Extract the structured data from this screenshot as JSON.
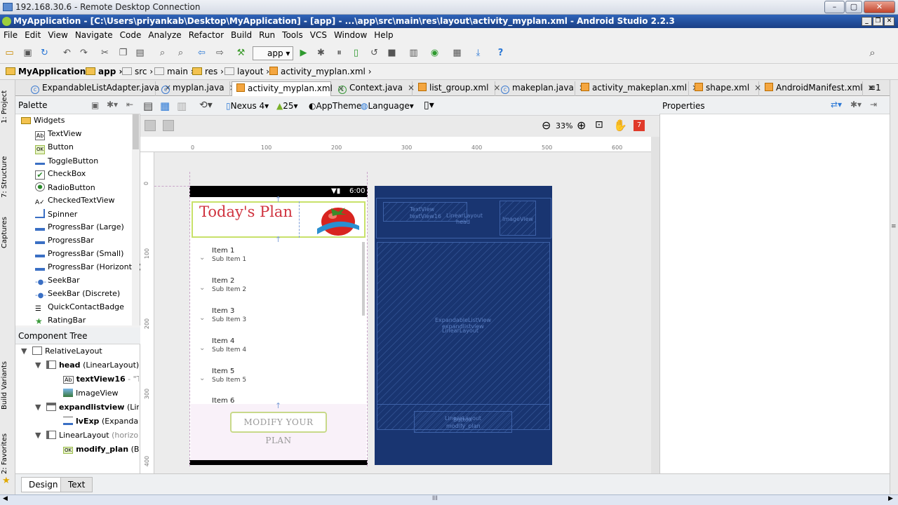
{
  "rdp": {
    "title": "192.168.30.6 - Remote Desktop Connection",
    "min": "–",
    "max": "▢",
    "close": "✕"
  },
  "window": {
    "title": "MyApplication - [C:\\Users\\priyankab\\Desktop\\MyApplication] - [app] - ...\\app\\src\\main\\res\\layout\\activity_myplan.xml - Android Studio 2.2.3"
  },
  "menu": [
    "File",
    "Edit",
    "View",
    "Navigate",
    "Code",
    "Analyze",
    "Refactor",
    "Build",
    "Run",
    "Tools",
    "VCS",
    "Window",
    "Help"
  ],
  "toolbar": {
    "app_config": "app",
    "help": "?"
  },
  "breadcrumb": [
    "MyApplication",
    "app",
    "src",
    "main",
    "res",
    "layout",
    "activity_myplan.xml"
  ],
  "tabs": [
    {
      "label": "ExpandableListAdapter.java",
      "type": "java"
    },
    {
      "label": "myplan.java",
      "type": "java"
    },
    {
      "label": "activity_myplan.xml",
      "type": "xml",
      "active": true
    },
    {
      "label": "Context.java",
      "type": "java"
    },
    {
      "label": "list_group.xml",
      "type": "xml"
    },
    {
      "label": "makeplan.java",
      "type": "java"
    },
    {
      "label": "activity_makeplan.xml",
      "type": "xml"
    },
    {
      "label": "shape.xml",
      "type": "xml"
    },
    {
      "label": "AndroidManifest.xml",
      "type": "xml"
    }
  ],
  "tabs_overflow": "≡1",
  "left_strip": [
    "1: Project",
    "7: Structure",
    "Captures",
    "Build Variants",
    "2: Favorites"
  ],
  "palette": {
    "title": "Palette",
    "group": "Widgets",
    "items": [
      "TextView",
      "Button",
      "ToggleButton",
      "CheckBox",
      "RadioButton",
      "CheckedTextView",
      "Spinner",
      "ProgressBar (Large)",
      "ProgressBar",
      "ProgressBar (Small)",
      "ProgressBar (Horizontal)",
      "SeekBar",
      "SeekBar (Discrete)",
      "QuickContactBadge",
      "RatingBar"
    ]
  },
  "component_tree": {
    "title": "Component Tree",
    "nodes": [
      {
        "name": "RelativeLayout",
        "extra": ""
      },
      {
        "name": "head",
        "extra": "(LinearLayout)",
        "trail": "(h"
      },
      {
        "name": "textView16",
        "extra": "- \"To"
      },
      {
        "name": "ImageView",
        "extra": ""
      },
      {
        "name": "expandlistview",
        "extra": "(Line"
      },
      {
        "name": "lvExp",
        "extra": "(Expandable"
      },
      {
        "name": "LinearLayout",
        "extra": "(horizonta"
      },
      {
        "name": "modify_plan",
        "extra": "(Bu"
      }
    ]
  },
  "editor_toolbar": {
    "device": "Nexus 4",
    "api": "25",
    "theme": "AppTheme",
    "language": "Language",
    "zoom": "33%",
    "warnings": "7"
  },
  "ruler": {
    "h": [
      "0",
      "100",
      "200",
      "300",
      "400",
      "500",
      "600"
    ],
    "v": [
      "0",
      "100",
      "200",
      "300",
      "400"
    ]
  },
  "device": {
    "time": "6:00",
    "title": "Today's Plan",
    "items": [
      {
        "title": "Item 1",
        "sub": "Sub Item 1"
      },
      {
        "title": "Item 2",
        "sub": "Sub Item 2"
      },
      {
        "title": "Item 3",
        "sub": "Sub Item 3"
      },
      {
        "title": "Item 4",
        "sub": "Sub Item 4"
      },
      {
        "title": "Item 5",
        "sub": "Sub Item 5"
      },
      {
        "title": "Item 6",
        "sub": ""
      }
    ],
    "button": "MODIFY YOUR PLAN"
  },
  "blueprint": {
    "textview": "TextView",
    "textview_id": "textView16",
    "head": "LinearLayout",
    "head_id": "head",
    "image": "ImageView",
    "list_a": "ExpandableListView",
    "list_b": "expandlistview",
    "list_c": "LinearLayout",
    "bottom_a": "LinearLayout",
    "bottom_b": "Button",
    "bottom_c": "modify_plan"
  },
  "properties": {
    "title": "Properties"
  },
  "bottom_tabs": [
    "Design",
    "Text"
  ],
  "hscroll_mark": "III"
}
